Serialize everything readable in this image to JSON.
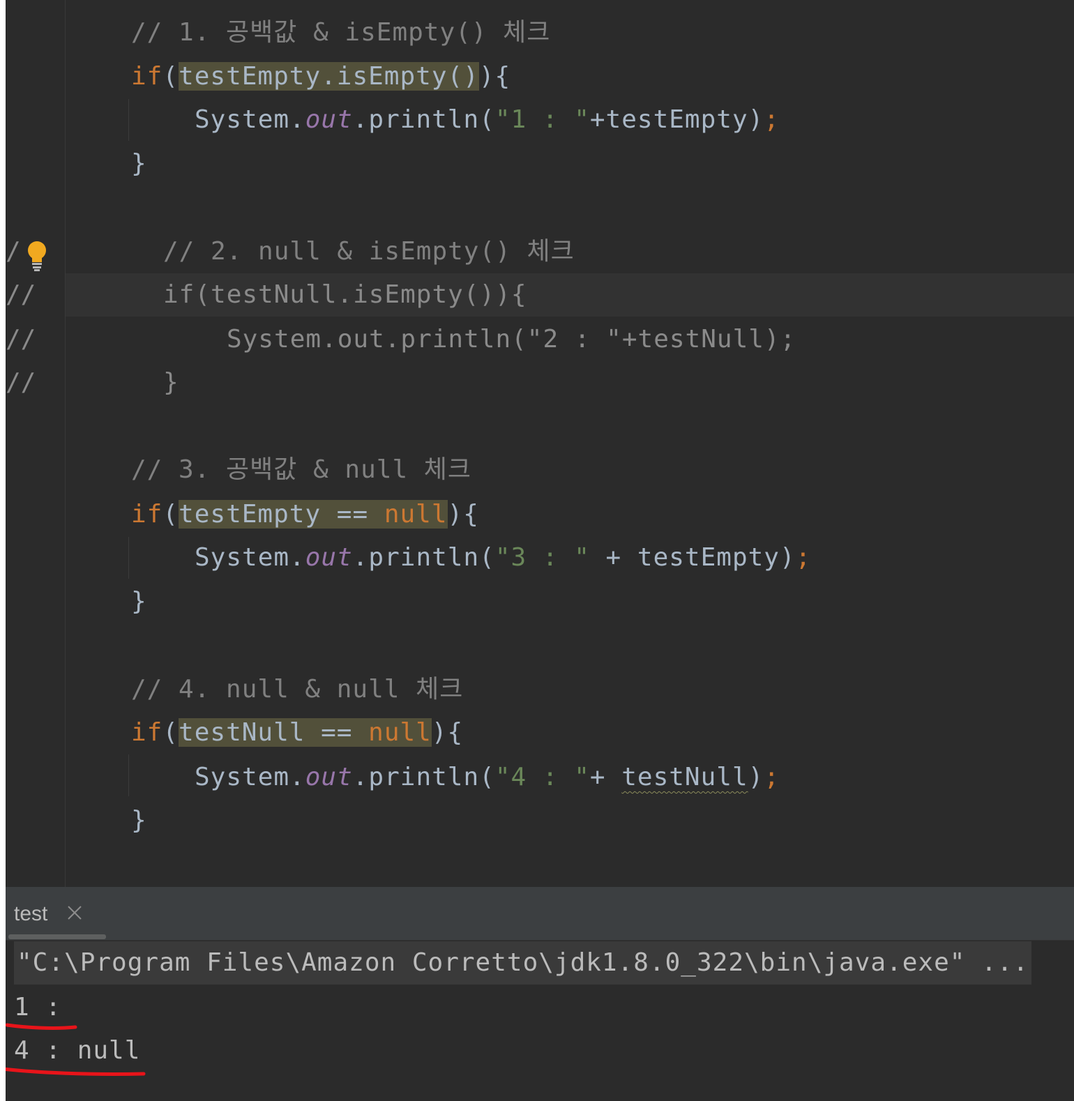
{
  "editor": {
    "lines": {
      "c1": "// 1. 공백값 & isEmpty() 체크",
      "c2": "// 2. null & isEmpty() 체크",
      "c3": "// 3. 공백값 & null 체크",
      "c4": "// 4. null & null 체크",
      "b2_if": "if(testNull.isEmpty()){",
      "b2_print": "System.out.println(\"2 : \"+testNull);",
      "b2_close": "}"
    },
    "tokens": {
      "if": "if",
      "paren_open": "(",
      "close_brace_open": "){",
      "close_brace": "}",
      "system": "System.",
      "out": "out",
      "println": ".println(",
      "semicolon": ";",
      "b1_cond": "testEmpty.isEmpty()",
      "b1_str": "\"1 : \"",
      "b1_rest": "+testEmpty)",
      "b3_cond_a": "testEmpty == ",
      "b3_null": "null",
      "b3_str": "\"3 : \"",
      "b3_rest": " + testEmpty)",
      "b4_cond_a": "testNull == ",
      "b4_null": "null",
      "b4_str": "\"4 : \"",
      "b4_plus": "+ ",
      "b4_var": "testNull",
      "b4_close": ")"
    },
    "gutter_marks": [
      "/",
      "//",
      "//",
      "//"
    ],
    "icons": {
      "intention": "lightbulb-icon"
    }
  },
  "run_panel": {
    "tab_label": "test",
    "command": "\"C:\\Program Files\\Amazon Corretto\\jdk1.8.0_322\\bin\\java.exe\" ...",
    "output": [
      "1 :",
      "4 : null"
    ]
  },
  "colors": {
    "editor_bg": "#2b2b2b",
    "keyword": "#cc7832",
    "string": "#6a8759",
    "field": "#9876aa",
    "comment": "#808080",
    "highlight": "#52503a",
    "annotation_red": "#e8141a"
  }
}
